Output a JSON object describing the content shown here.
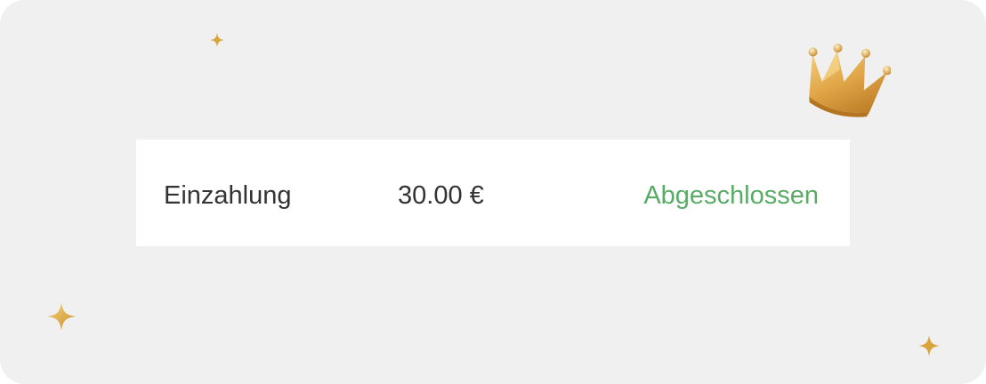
{
  "transaction": {
    "type": "Einzahlung",
    "amount": "30.00 €",
    "status": "Abgeschlossen"
  },
  "colors": {
    "card_background": "#f0f0f0",
    "row_background": "#ffffff",
    "text": "#333333",
    "status_success": "#5aab66",
    "gold": "#d9a43a"
  },
  "decorations": {
    "crown_icon": "crown-icon",
    "sparkle_icon": "sparkle-icon"
  }
}
